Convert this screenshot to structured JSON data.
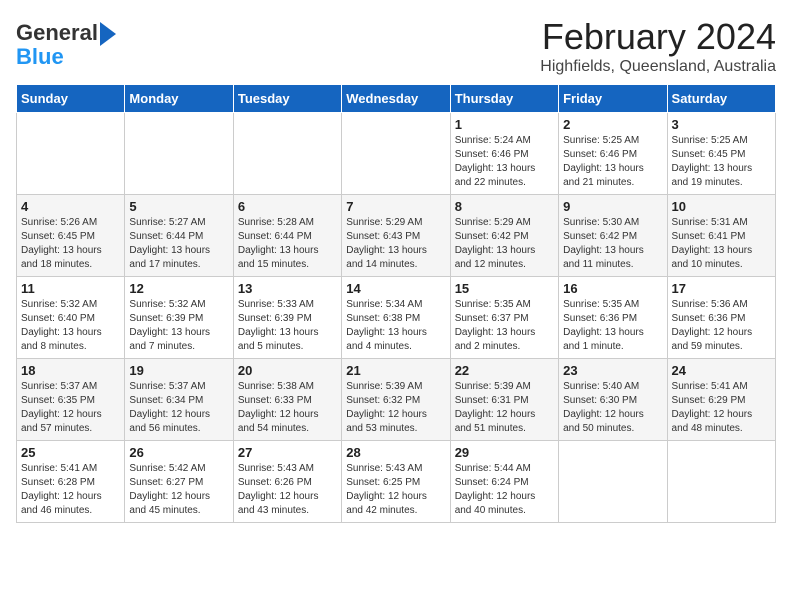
{
  "logo": {
    "line1": "General",
    "line2": "Blue"
  },
  "title": "February 2024",
  "subtitle": "Highfields, Queensland, Australia",
  "days_of_week": [
    "Sunday",
    "Monday",
    "Tuesday",
    "Wednesday",
    "Thursday",
    "Friday",
    "Saturday"
  ],
  "weeks": [
    [
      {
        "day": "",
        "info": ""
      },
      {
        "day": "",
        "info": ""
      },
      {
        "day": "",
        "info": ""
      },
      {
        "day": "",
        "info": ""
      },
      {
        "day": "1",
        "info": "Sunrise: 5:24 AM\nSunset: 6:46 PM\nDaylight: 13 hours\nand 22 minutes."
      },
      {
        "day": "2",
        "info": "Sunrise: 5:25 AM\nSunset: 6:46 PM\nDaylight: 13 hours\nand 21 minutes."
      },
      {
        "day": "3",
        "info": "Sunrise: 5:25 AM\nSunset: 6:45 PM\nDaylight: 13 hours\nand 19 minutes."
      }
    ],
    [
      {
        "day": "4",
        "info": "Sunrise: 5:26 AM\nSunset: 6:45 PM\nDaylight: 13 hours\nand 18 minutes."
      },
      {
        "day": "5",
        "info": "Sunrise: 5:27 AM\nSunset: 6:44 PM\nDaylight: 13 hours\nand 17 minutes."
      },
      {
        "day": "6",
        "info": "Sunrise: 5:28 AM\nSunset: 6:44 PM\nDaylight: 13 hours\nand 15 minutes."
      },
      {
        "day": "7",
        "info": "Sunrise: 5:29 AM\nSunset: 6:43 PM\nDaylight: 13 hours\nand 14 minutes."
      },
      {
        "day": "8",
        "info": "Sunrise: 5:29 AM\nSunset: 6:42 PM\nDaylight: 13 hours\nand 12 minutes."
      },
      {
        "day": "9",
        "info": "Sunrise: 5:30 AM\nSunset: 6:42 PM\nDaylight: 13 hours\nand 11 minutes."
      },
      {
        "day": "10",
        "info": "Sunrise: 5:31 AM\nSunset: 6:41 PM\nDaylight: 13 hours\nand 10 minutes."
      }
    ],
    [
      {
        "day": "11",
        "info": "Sunrise: 5:32 AM\nSunset: 6:40 PM\nDaylight: 13 hours\nand 8 minutes."
      },
      {
        "day": "12",
        "info": "Sunrise: 5:32 AM\nSunset: 6:39 PM\nDaylight: 13 hours\nand 7 minutes."
      },
      {
        "day": "13",
        "info": "Sunrise: 5:33 AM\nSunset: 6:39 PM\nDaylight: 13 hours\nand 5 minutes."
      },
      {
        "day": "14",
        "info": "Sunrise: 5:34 AM\nSunset: 6:38 PM\nDaylight: 13 hours\nand 4 minutes."
      },
      {
        "day": "15",
        "info": "Sunrise: 5:35 AM\nSunset: 6:37 PM\nDaylight: 13 hours\nand 2 minutes."
      },
      {
        "day": "16",
        "info": "Sunrise: 5:35 AM\nSunset: 6:36 PM\nDaylight: 13 hours\nand 1 minute."
      },
      {
        "day": "17",
        "info": "Sunrise: 5:36 AM\nSunset: 6:36 PM\nDaylight: 12 hours\nand 59 minutes."
      }
    ],
    [
      {
        "day": "18",
        "info": "Sunrise: 5:37 AM\nSunset: 6:35 PM\nDaylight: 12 hours\nand 57 minutes."
      },
      {
        "day": "19",
        "info": "Sunrise: 5:37 AM\nSunset: 6:34 PM\nDaylight: 12 hours\nand 56 minutes."
      },
      {
        "day": "20",
        "info": "Sunrise: 5:38 AM\nSunset: 6:33 PM\nDaylight: 12 hours\nand 54 minutes."
      },
      {
        "day": "21",
        "info": "Sunrise: 5:39 AM\nSunset: 6:32 PM\nDaylight: 12 hours\nand 53 minutes."
      },
      {
        "day": "22",
        "info": "Sunrise: 5:39 AM\nSunset: 6:31 PM\nDaylight: 12 hours\nand 51 minutes."
      },
      {
        "day": "23",
        "info": "Sunrise: 5:40 AM\nSunset: 6:30 PM\nDaylight: 12 hours\nand 50 minutes."
      },
      {
        "day": "24",
        "info": "Sunrise: 5:41 AM\nSunset: 6:29 PM\nDaylight: 12 hours\nand 48 minutes."
      }
    ],
    [
      {
        "day": "25",
        "info": "Sunrise: 5:41 AM\nSunset: 6:28 PM\nDaylight: 12 hours\nand 46 minutes."
      },
      {
        "day": "26",
        "info": "Sunrise: 5:42 AM\nSunset: 6:27 PM\nDaylight: 12 hours\nand 45 minutes."
      },
      {
        "day": "27",
        "info": "Sunrise: 5:43 AM\nSunset: 6:26 PM\nDaylight: 12 hours\nand 43 minutes."
      },
      {
        "day": "28",
        "info": "Sunrise: 5:43 AM\nSunset: 6:25 PM\nDaylight: 12 hours\nand 42 minutes."
      },
      {
        "day": "29",
        "info": "Sunrise: 5:44 AM\nSunset: 6:24 PM\nDaylight: 12 hours\nand 40 minutes."
      },
      {
        "day": "",
        "info": ""
      },
      {
        "day": "",
        "info": ""
      }
    ]
  ]
}
